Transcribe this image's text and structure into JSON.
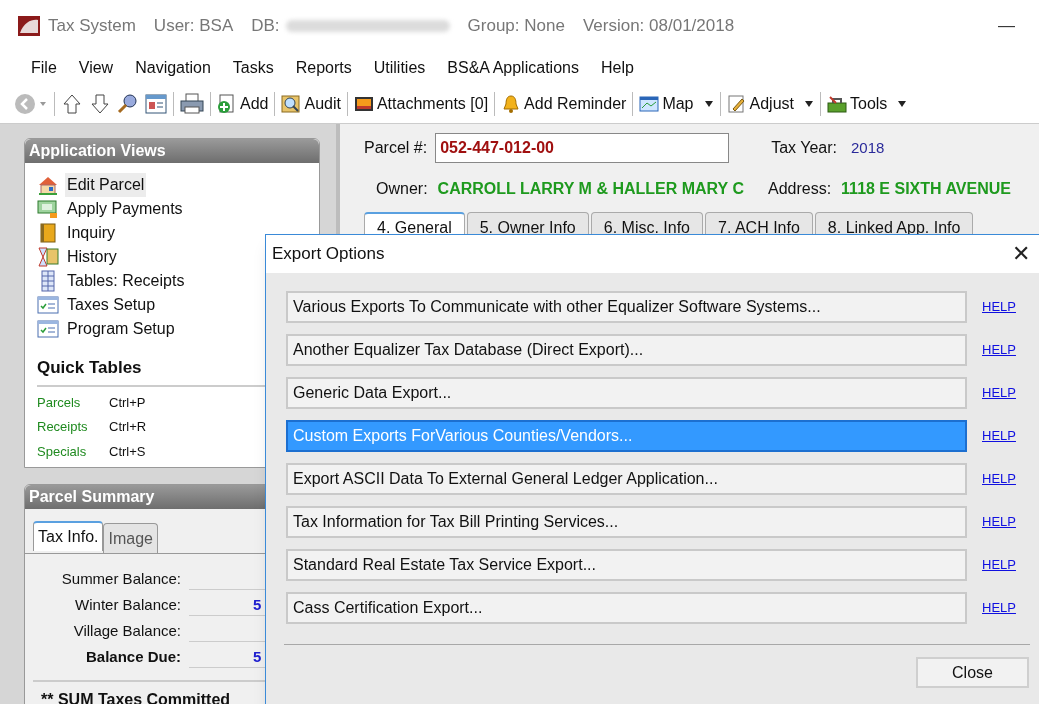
{
  "title_bar": {
    "app": "Tax System",
    "user": "User: BSA",
    "db": "DB:",
    "group": "Group: None",
    "version": "Version: 08/01/2018",
    "minimize": "—"
  },
  "menu": [
    "File",
    "View",
    "Navigation",
    "Tasks",
    "Reports",
    "Utilities",
    "BS&A Applications",
    "Help"
  ],
  "toolbar": [
    {
      "kind": "add",
      "label": "Add",
      "dropdown": false
    },
    {
      "kind": "audit",
      "label": "Audit",
      "dropdown": false
    },
    {
      "kind": "attach",
      "label": "Attachments [0]",
      "dropdown": false
    },
    {
      "kind": "bell",
      "label": "Add Reminder",
      "dropdown": false
    },
    {
      "kind": "map",
      "label": "Map",
      "dropdown": true
    },
    {
      "kind": "adjust",
      "label": "Adjust",
      "dropdown": true
    },
    {
      "kind": "tools",
      "label": "Tools",
      "dropdown": true
    }
  ],
  "application_views": {
    "title": "Application Views",
    "items": [
      {
        "kind": "house",
        "label": "Edit Parcel",
        "selected": true
      },
      {
        "kind": "money",
        "label": "Apply Payments",
        "selected": false
      },
      {
        "kind": "book",
        "label": "Inquiry",
        "selected": false
      },
      {
        "kind": "hourglass",
        "label": "History",
        "selected": false
      },
      {
        "kind": "table",
        "label": "Tables: Receipts",
        "selected": false
      },
      {
        "kind": "setup",
        "label": "Taxes Setup",
        "selected": false
      },
      {
        "kind": "setup",
        "label": "Program Setup",
        "selected": false
      }
    ]
  },
  "quick_tables": {
    "title": "Quick Tables",
    "items": [
      {
        "label": "Parcels",
        "shortcut": "Ctrl+P"
      },
      {
        "label": "Receipts",
        "shortcut": "Ctrl+R"
      },
      {
        "label": "Specials",
        "shortcut": "Ctrl+S"
      }
    ]
  },
  "parcel_summary": {
    "title": "Parcel Summary",
    "tabs": [
      {
        "label": "Tax Info.",
        "selected": true
      },
      {
        "label": "Image",
        "selected": false
      }
    ],
    "rows": [
      {
        "label": "Summer Balance:",
        "value": "",
        "bold": false
      },
      {
        "label": "Winter Balance:",
        "value": "5",
        "bold": false
      },
      {
        "label": "Village Balance:",
        "value": "",
        "bold": false
      },
      {
        "label": "Balance Due:",
        "value": "5",
        "bold": true
      }
    ],
    "footer": "** SUM Taxes Committed"
  },
  "parcel": {
    "parcel_label": "Parcel #:",
    "parcel_value": "052-447-012-00",
    "tax_year_label": "Tax Year:",
    "tax_year": "2018",
    "owner_label": "Owner:",
    "owner": "CARROLL LARRY M & HALLER MARY C",
    "address_label": "Address:",
    "address": "1118 E SIXTH AVENUE",
    "tabs": [
      {
        "label": "4. General",
        "selected": true
      },
      {
        "label": "5. Owner Info",
        "selected": false
      },
      {
        "label": "6. Misc. Info",
        "selected": false
      },
      {
        "label": "7. ACH Info",
        "selected": false
      },
      {
        "label": "8. Linked App. Info",
        "selected": false
      }
    ]
  },
  "dialog": {
    "title": "Export Options",
    "close_glyph": "✕",
    "options": [
      {
        "label": "Various Exports To Communicate with other Equalizer Software Systems...",
        "selected": false,
        "help": "HELP"
      },
      {
        "label": "Another Equalizer Tax Database (Direct Export)...",
        "selected": false,
        "help": "HELP"
      },
      {
        "label": "Generic Data Export...",
        "selected": false,
        "help": "HELP"
      },
      {
        "label": "Custom Exports ForVarious Counties/Vendors...",
        "selected": true,
        "help": "HELP"
      },
      {
        "label": "Export ASCII Data To External General Ledger Application...",
        "selected": false,
        "help": "HELP"
      },
      {
        "label": "Tax Information for Tax Bill Printing Services...",
        "selected": false,
        "help": "HELP"
      },
      {
        "label": "Standard Real Estate Tax Service Export...",
        "selected": false,
        "help": "HELP"
      },
      {
        "label": "Cass Certification Export...",
        "selected": false,
        "help": "HELP"
      }
    ],
    "close": "Close"
  }
}
